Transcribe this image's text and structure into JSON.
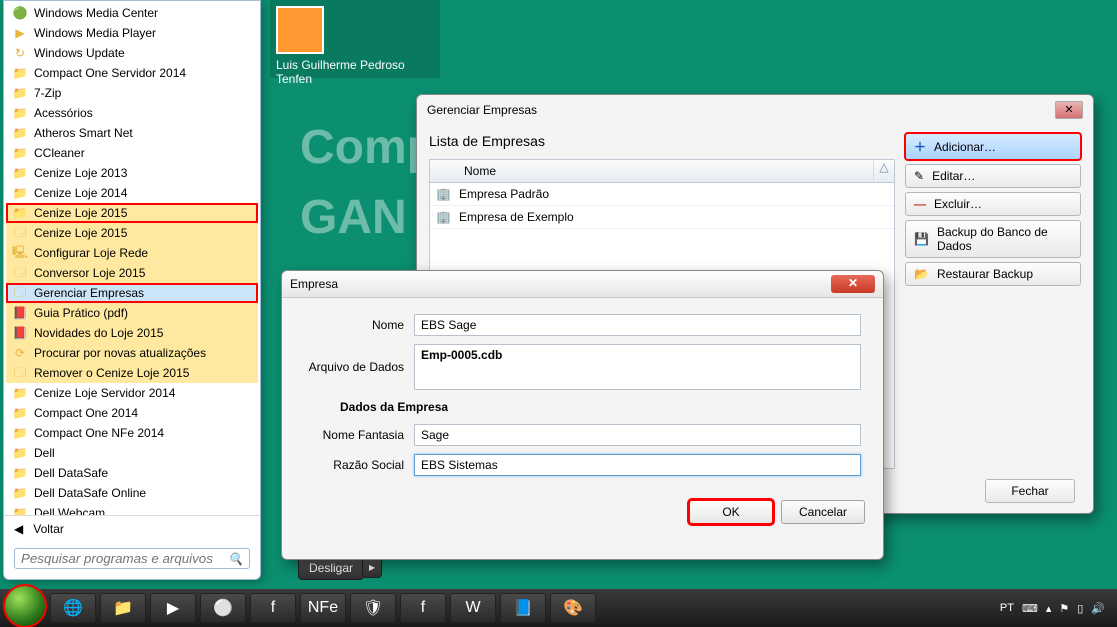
{
  "desktop": {
    "user_name": "Luis Guilherme Pedroso Tenfen",
    "bg_words": [
      "Compro",
      "GAN"
    ]
  },
  "start_menu": {
    "items": [
      {
        "label": "Windows Media Center",
        "ico": "🟢",
        "cls": ""
      },
      {
        "label": "Windows Media Player",
        "ico": "▶",
        "cls": ""
      },
      {
        "label": "Windows Update",
        "ico": "↻",
        "cls": ""
      },
      {
        "label": " Compact One Servidor 2014",
        "ico": "📁",
        "cls": ""
      },
      {
        "label": "7-Zip",
        "ico": "📁",
        "cls": ""
      },
      {
        "label": "Acessórios",
        "ico": "📁",
        "cls": ""
      },
      {
        "label": "Atheros Smart Net",
        "ico": "📁",
        "cls": ""
      },
      {
        "label": "CCleaner",
        "ico": "📁",
        "cls": ""
      },
      {
        "label": "Cenize Loje 2013",
        "ico": "📁",
        "cls": ""
      },
      {
        "label": "Cenize Loje 2014",
        "ico": "📁",
        "cls": ""
      },
      {
        "label": "Cenize Loje 2015",
        "ico": "📁",
        "cls": "sel-red hl-yellow"
      },
      {
        "label": "Cenize Loje 2015",
        "ico": "🗔",
        "cls": "hl-yellow"
      },
      {
        "label": "Configurar Loje Rede",
        "ico": "🖳",
        "cls": "hl-yellow"
      },
      {
        "label": "Conversor Loje 2015",
        "ico": "🗔",
        "cls": "hl-yellow"
      },
      {
        "label": "Gerenciar Empresas",
        "ico": "🗔",
        "cls": "sel-red hl-blue"
      },
      {
        "label": "Guia Prático (pdf)",
        "ico": "📕",
        "cls": "hl-yellow"
      },
      {
        "label": "Novidades do Loje 2015",
        "ico": "📕",
        "cls": "hl-yellow"
      },
      {
        "label": "Procurar por novas atualizações",
        "ico": "⟳",
        "cls": "hl-yellow"
      },
      {
        "label": "Remover o Cenize Loje 2015",
        "ico": "🗔",
        "cls": "hl-yellow"
      },
      {
        "label": "Cenize Loje Servidor  2014",
        "ico": "📁",
        "cls": ""
      },
      {
        "label": "Compact One 2014",
        "ico": "📁",
        "cls": ""
      },
      {
        "label": "Compact One NFe 2014",
        "ico": "📁",
        "cls": ""
      },
      {
        "label": "Dell",
        "ico": "📁",
        "cls": ""
      },
      {
        "label": "Dell DataSafe",
        "ico": "📁",
        "cls": ""
      },
      {
        "label": "Dell DataSafe Online",
        "ico": "📁",
        "cls": ""
      },
      {
        "label": "Dell Webcam",
        "ico": "📁",
        "cls": ""
      }
    ],
    "back_label": "Voltar",
    "search_placeholder": "Pesquisar programas e arquivos",
    "shutdown_label": "Desligar"
  },
  "gerenciar": {
    "title": "Gerenciar Empresas",
    "list_title": "Lista de Empresas",
    "col_name": "Nome",
    "rows": [
      {
        "label": "Empresa Padrão"
      },
      {
        "label": "Empresa de Exemplo"
      }
    ],
    "buttons": {
      "add": "Adicionar…",
      "edit": "Editar…",
      "del": "Excluir…",
      "backup": "Backup do Banco de Dados",
      "restore": "Restaurar Backup",
      "close": "Fechar"
    }
  },
  "empresa": {
    "title": "Empresa",
    "labels": {
      "nome": "Nome",
      "arquivo": "Arquivo de Dados",
      "section": "Dados da Empresa",
      "fantasia": "Nome Fantasia",
      "razao": "Razão Social"
    },
    "values": {
      "nome": "EBS Sage",
      "arquivo": "Emp-0005.cdb",
      "fantasia": "Sage",
      "razao": "EBS Sistemas"
    },
    "buttons": {
      "ok": "OK",
      "cancel": "Cancelar"
    }
  },
  "taskbar": {
    "lang": "PT",
    "icons": [
      "🌐",
      "📁",
      "▶",
      "⚪",
      "f",
      "NFe",
      "🛡",
      "f",
      "W",
      "📘",
      "🎨"
    ]
  }
}
